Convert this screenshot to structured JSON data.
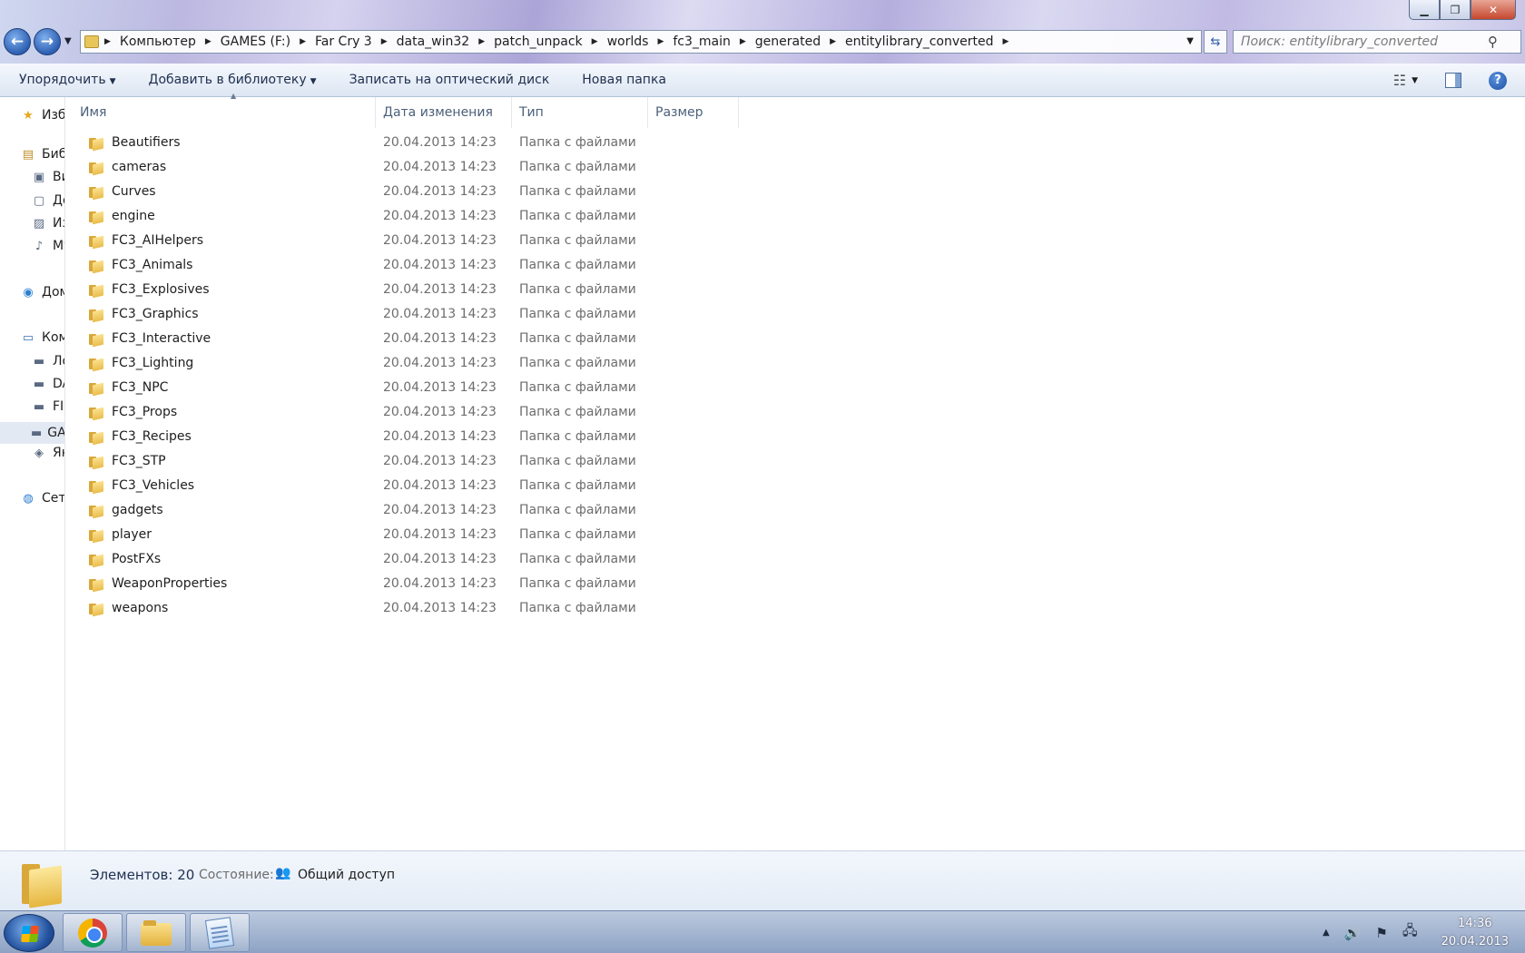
{
  "window": {
    "min_label": "▁",
    "max_label": "❐",
    "close_label": "✕"
  },
  "address": {
    "crumbs": [
      "Компьютер",
      "GAMES (F:)",
      "Far Cry 3",
      "data_win32",
      "patch_unpack",
      "worlds",
      "fc3_main",
      "generated",
      "entitylibrary_converted"
    ]
  },
  "search": {
    "placeholder": "Поиск: entitylibrary_converted"
  },
  "toolbar": {
    "organize": "Упорядочить",
    "add_library": "Добавить в библиотеку",
    "burn": "Записать на оптический диск",
    "new_folder": "Новая папка"
  },
  "navpane": {
    "items": [
      {
        "label": "Избранное",
        "icon": "star-icon"
      },
      {
        "label": "Библиотеки",
        "icon": "library-icon"
      },
      {
        "label": "Видео",
        "icon": "video-library-icon"
      },
      {
        "label": "Документы",
        "icon": "documents-library-icon"
      },
      {
        "label": "Изображения",
        "icon": "pictures-library-icon"
      },
      {
        "label": "Музыка",
        "icon": "music-library-icon"
      },
      {
        "label": "Домашняя группа",
        "icon": "homegroup-icon"
      },
      {
        "label": "Компьютер",
        "icon": "computer-icon"
      },
      {
        "label": "Локальный диск",
        "icon": "drive-icon"
      },
      {
        "label": "DATA",
        "icon": "drive-icon"
      },
      {
        "label": "FILES",
        "icon": "drive-icon"
      },
      {
        "label": "GAMES (F:)",
        "icon": "drive-icon"
      },
      {
        "label": "Яндекс.Диск",
        "icon": "network-drive-icon"
      },
      {
        "label": "Сеть",
        "icon": "network-icon"
      }
    ]
  },
  "columns": {
    "name": "Имя",
    "date": "Дата изменения",
    "type": "Тип",
    "size": "Размер"
  },
  "files": [
    {
      "name": "Beautifiers",
      "date": "20.04.2013 14:23",
      "type": "Папка с файлами"
    },
    {
      "name": "cameras",
      "date": "20.04.2013 14:23",
      "type": "Папка с файлами"
    },
    {
      "name": "Curves",
      "date": "20.04.2013 14:23",
      "type": "Папка с файлами"
    },
    {
      "name": "engine",
      "date": "20.04.2013 14:23",
      "type": "Папка с файлами"
    },
    {
      "name": "FC3_AIHelpers",
      "date": "20.04.2013 14:23",
      "type": "Папка с файлами"
    },
    {
      "name": "FC3_Animals",
      "date": "20.04.2013 14:23",
      "type": "Папка с файлами"
    },
    {
      "name": "FC3_Explosives",
      "date": "20.04.2013 14:23",
      "type": "Папка с файлами"
    },
    {
      "name": "FC3_Graphics",
      "date": "20.04.2013 14:23",
      "type": "Папка с файлами"
    },
    {
      "name": "FC3_Interactive",
      "date": "20.04.2013 14:23",
      "type": "Папка с файлами"
    },
    {
      "name": "FC3_Lighting",
      "date": "20.04.2013 14:23",
      "type": "Папка с файлами"
    },
    {
      "name": "FC3_NPC",
      "date": "20.04.2013 14:23",
      "type": "Папка с файлами"
    },
    {
      "name": "FC3_Props",
      "date": "20.04.2013 14:23",
      "type": "Папка с файлами"
    },
    {
      "name": "FC3_Recipes",
      "date": "20.04.2013 14:23",
      "type": "Папка с файлами"
    },
    {
      "name": "FC3_STP",
      "date": "20.04.2013 14:23",
      "type": "Папка с файлами"
    },
    {
      "name": "FC3_Vehicles",
      "date": "20.04.2013 14:23",
      "type": "Папка с файлами"
    },
    {
      "name": "gadgets",
      "date": "20.04.2013 14:23",
      "type": "Папка с файлами"
    },
    {
      "name": "player",
      "date": "20.04.2013 14:23",
      "type": "Папка с файлами"
    },
    {
      "name": "PostFXs",
      "date": "20.04.2013 14:23",
      "type": "Папка с файлами"
    },
    {
      "name": "WeaponProperties",
      "date": "20.04.2013 14:23",
      "type": "Папка с файлами"
    },
    {
      "name": "weapons",
      "date": "20.04.2013 14:23",
      "type": "Папка с файлами"
    }
  ],
  "details": {
    "count": "Элементов: 20",
    "state_label": "Состояние:",
    "state_value": "Общий доступ"
  },
  "taskbar": {
    "apps": [
      "chrome-icon",
      "explorer-icon",
      "notepad-icon"
    ],
    "time": "14:36",
    "date": "20.04.2013"
  },
  "colors": {
    "accent": "#2d5fb2",
    "folder": "#e9bd4c"
  }
}
